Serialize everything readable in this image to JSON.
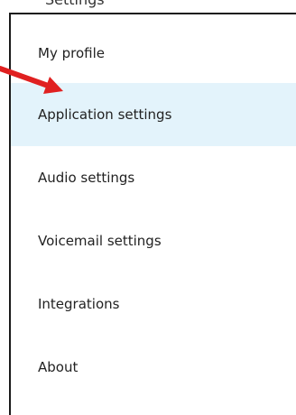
{
  "header": {
    "partial_title": "Settings"
  },
  "menu": {
    "items": [
      {
        "label": "My profile",
        "selected": false
      },
      {
        "label": "Application settings",
        "selected": true
      },
      {
        "label": "Audio settings",
        "selected": false
      },
      {
        "label": "Voicemail settings",
        "selected": false
      },
      {
        "label": "Integrations",
        "selected": false
      },
      {
        "label": "About",
        "selected": false
      }
    ]
  },
  "colors": {
    "selected_background": "#e3f3fb",
    "arrow": "#e02020",
    "border": "#1a1a1a"
  },
  "icons": {
    "annotation": "red-arrow-icon"
  }
}
